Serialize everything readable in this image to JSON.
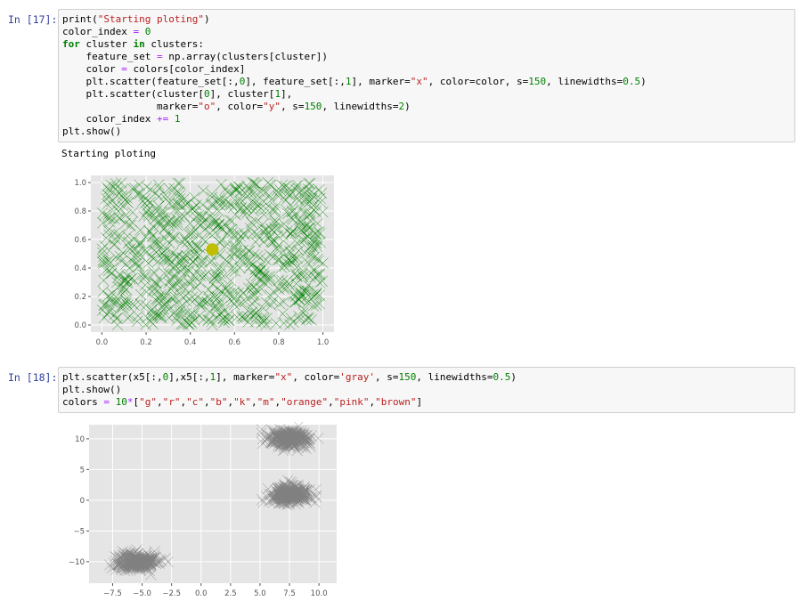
{
  "cells": [
    {
      "prompt": "In [17]:",
      "code": [
        [
          [
            "print(",
            ""
          ],
          [
            "\"Starting ploting\"",
            "str"
          ],
          [
            ")",
            ""
          ]
        ],
        [
          [
            "color_index ",
            ""
          ],
          [
            "=",
            "op"
          ],
          [
            " ",
            ""
          ],
          [
            "0",
            "num"
          ]
        ],
        [
          [
            "for",
            "kw"
          ],
          [
            " cluster ",
            ""
          ],
          [
            "in",
            "kw"
          ],
          [
            " clusters:",
            ""
          ]
        ],
        [
          [
            "    feature_set ",
            ""
          ],
          [
            "=",
            "op"
          ],
          [
            " np.array(clusters[cluster])",
            ""
          ]
        ],
        [
          [
            "    color ",
            ""
          ],
          [
            "=",
            "op"
          ],
          [
            " colors[color_index]",
            ""
          ]
        ],
        [
          [
            "    plt.scatter(feature_set[:,",
            ""
          ],
          [
            "0",
            "num"
          ],
          [
            "], feature_set[:,",
            ""
          ],
          [
            "1",
            "num"
          ],
          [
            "], marker=",
            ""
          ],
          [
            "\"x\"",
            "str"
          ],
          [
            ", color=color, s=",
            ""
          ],
          [
            "150",
            "num"
          ],
          [
            ", linewidths=",
            ""
          ],
          [
            "0.5",
            "num"
          ],
          [
            ")",
            ""
          ]
        ],
        [
          [
            "    plt.scatter(cluster[",
            ""
          ],
          [
            "0",
            "num"
          ],
          [
            "], cluster[",
            ""
          ],
          [
            "1",
            "num"
          ],
          [
            "],",
            ""
          ]
        ],
        [
          [
            "                marker=",
            ""
          ],
          [
            "\"o\"",
            "str"
          ],
          [
            ", color=",
            ""
          ],
          [
            "\"y\"",
            "str"
          ],
          [
            ", s=",
            ""
          ],
          [
            "150",
            "num"
          ],
          [
            ", linewidths=",
            ""
          ],
          [
            "2",
            "num"
          ],
          [
            ")",
            ""
          ]
        ],
        [
          [
            "    color_index ",
            ""
          ],
          [
            "+=",
            "op"
          ],
          [
            " ",
            ""
          ],
          [
            "1",
            "num"
          ]
        ],
        [
          [
            "plt.show()",
            ""
          ]
        ]
      ],
      "stdout": "Starting ploting"
    },
    {
      "prompt": "In [18]:",
      "code": [
        [
          [
            "plt.scatter(x5[:,",
            ""
          ],
          [
            "0",
            "num"
          ],
          [
            "],x5[:,",
            ""
          ],
          [
            "1",
            "num"
          ],
          [
            "], marker=",
            ""
          ],
          [
            "\"x\"",
            "str"
          ],
          [
            ", color=",
            ""
          ],
          [
            "'gray'",
            "str"
          ],
          [
            ", s=",
            ""
          ],
          [
            "150",
            "num"
          ],
          [
            ", linewidths=",
            ""
          ],
          [
            "0.5",
            "num"
          ],
          [
            ")",
            ""
          ]
        ],
        [
          [
            "plt.show()",
            ""
          ]
        ],
        [
          [
            "colors ",
            ""
          ],
          [
            "=",
            "op"
          ],
          [
            " ",
            ""
          ],
          [
            "10",
            "num"
          ],
          [
            "*",
            "op"
          ],
          [
            "[",
            ""
          ],
          [
            "\"g\"",
            "str"
          ],
          [
            ",",
            ""
          ],
          [
            "\"r\"",
            "str"
          ],
          [
            ",",
            ""
          ],
          [
            "\"c\"",
            "str"
          ],
          [
            ",",
            ""
          ],
          [
            "\"b\"",
            "str"
          ],
          [
            ",",
            ""
          ],
          [
            "\"k\"",
            "str"
          ],
          [
            ",",
            ""
          ],
          [
            "\"m\"",
            "str"
          ],
          [
            ",",
            ""
          ],
          [
            "\"orange\"",
            "str"
          ],
          [
            ",",
            ""
          ],
          [
            "\"pink\"",
            "str"
          ],
          [
            ",",
            ""
          ],
          [
            "\"brown\"",
            "str"
          ],
          [
            "]",
            ""
          ]
        ]
      ]
    }
  ],
  "chart_data": [
    {
      "type": "scatter",
      "title": "",
      "xlabel": "",
      "ylabel": "",
      "xlim": [
        -0.05,
        1.05
      ],
      "ylim": [
        -0.05,
        1.05
      ],
      "xticks": [
        "0.0",
        "0.2",
        "0.4",
        "0.6",
        "0.8",
        "1.0"
      ],
      "yticks": [
        "0.0",
        "0.2",
        "0.4",
        "0.6",
        "0.8",
        "1.0"
      ],
      "grid": true,
      "series": [
        {
          "marker": "x",
          "color": "#008000",
          "distribution": "uniform",
          "x_range": [
            0,
            1
          ],
          "y_range": [
            0,
            1
          ]
        },
        {
          "marker": "o",
          "color": "#bfbf00",
          "points": [
            [
              0.5,
              0.53
            ]
          ]
        }
      ]
    },
    {
      "type": "scatter",
      "title": "",
      "xlabel": "",
      "ylabel": "",
      "xlim": [
        -9.5,
        11.5
      ],
      "ylim": [
        -13.5,
        12.3
      ],
      "xticks": [
        "−7.5",
        "−5.0",
        "−2.5",
        "0.0",
        "2.5",
        "5.0",
        "7.5",
        "10.0"
      ],
      "yticks": [
        "−10",
        "−5",
        "0",
        "5",
        "10"
      ],
      "grid": true,
      "series": [
        {
          "marker": "x",
          "color": "#808080",
          "clusters": [
            {
              "center": [
                -5.5,
                -10
              ],
              "spread": [
                1.4,
                1.1
              ]
            },
            {
              "center": [
                7.5,
                10
              ],
              "spread": [
                1.4,
                1.1
              ]
            },
            {
              "center": [
                7.5,
                1
              ],
              "spread": [
                1.4,
                1.1
              ]
            }
          ]
        }
      ]
    }
  ]
}
